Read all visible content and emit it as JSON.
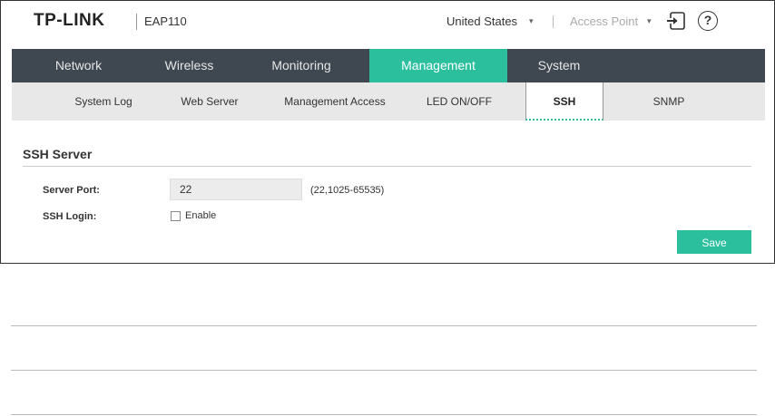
{
  "header": {
    "brand": "TP-LINK",
    "model": "EAP110",
    "region": "United States",
    "mode": "Access Point",
    "logout_icon": "logout-icon",
    "help_icon": "help-icon",
    "help_glyph": "?",
    "caret_glyph": "▾"
  },
  "main_nav": {
    "tabs": [
      {
        "label": "Network"
      },
      {
        "label": "Wireless"
      },
      {
        "label": "Monitoring"
      },
      {
        "label": "Management",
        "active": true
      },
      {
        "label": "System"
      }
    ]
  },
  "sub_nav": {
    "tabs": [
      {
        "label": "System Log"
      },
      {
        "label": "Web Server"
      },
      {
        "label": "Management Access"
      },
      {
        "label": "LED ON/OFF"
      },
      {
        "label": "SSH",
        "active": true
      },
      {
        "label": "SNMP"
      }
    ]
  },
  "ssh_server": {
    "title": "SSH Server",
    "server_port_label": "Server Port:",
    "server_port_value": "22",
    "server_port_hint": "(22,1025-65535)",
    "ssh_login_label": "SSH Login:",
    "enable_label": "Enable",
    "enable_checked": false,
    "save_label": "Save"
  },
  "colors": {
    "accent": "#2bbf9e",
    "nav_bg": "#3f4850",
    "subnav_bg": "#e8e8e8"
  }
}
